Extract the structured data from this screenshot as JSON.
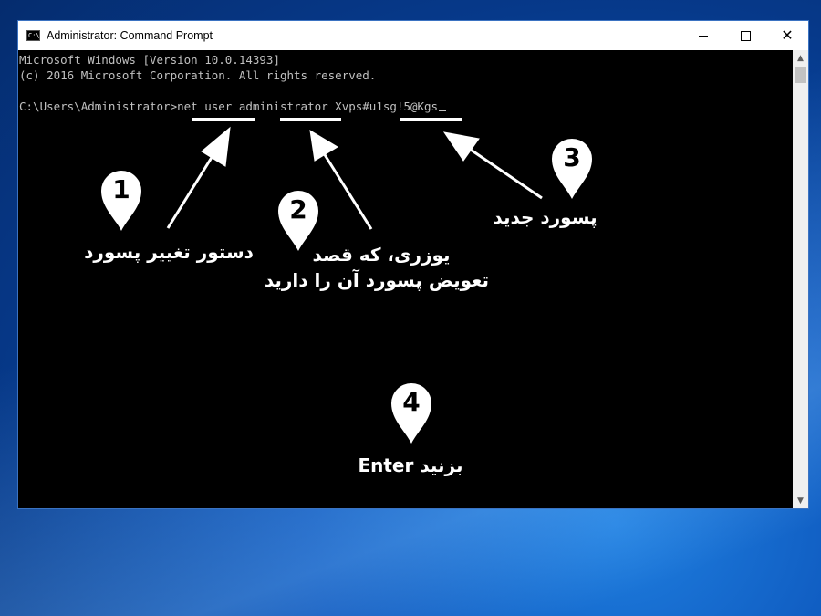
{
  "window": {
    "title": "Administrator: Command Prompt",
    "icon_text": "C:\\",
    "controls": {
      "minimize": "minimize-icon",
      "maximize": "maximize-icon",
      "close": "close-icon",
      "close_glyph": "✕"
    }
  },
  "console": {
    "line1": "Microsoft Windows [Version 10.0.14393]",
    "line2": "(c) 2016 Microsoft Corporation. All rights reserved.",
    "prompt": "C:\\Users\\Administrator>",
    "command": "net user administrator Xvps#u1sg!5@Kgs"
  },
  "scrollbar": {
    "up_glyph": "▲",
    "down_glyph": "▼"
  },
  "annotations": {
    "step1": {
      "number": "1",
      "label": "دستور تغییر پسورد"
    },
    "step2": {
      "number": "2",
      "label_line1": "یوزری، که قصد",
      "label_line2": "تعویض پسورد آن را دارید"
    },
    "step3": {
      "number": "3",
      "label": "پسورد جدید"
    },
    "step4": {
      "number": "4",
      "label": "Enter بزنید"
    }
  },
  "colors": {
    "console_bg": "#000000",
    "console_text": "#c0c0c0",
    "annotation": "#ffffff",
    "desktop": "#0b52b8"
  }
}
